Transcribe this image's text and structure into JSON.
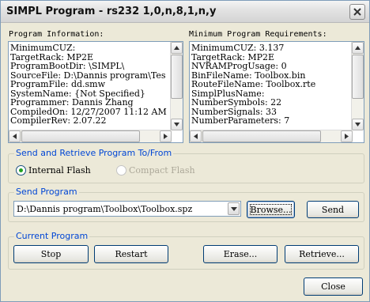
{
  "window": {
    "title": "SIMPL Program - rs232 1,0,n,8,1,n,y"
  },
  "program_info": {
    "label": "Program Information:",
    "lines": [
      "MinimumCUZ:",
      "TargetRack: MP2E",
      "ProgramBootDir: \\SIMPL\\",
      "SourceFile: D:\\Dannis program\\Tes",
      "ProgramFile: dd.smw",
      "SystemName: {Not Specified}",
      "Programmer: Dannis Zhang",
      "CompiledOn: 12/27/2007 11:12 AM",
      "CompilerRev: 2.07.22"
    ]
  },
  "min_requirements": {
    "label": "Minimum Program Requirements:",
    "lines": [
      "MinimumCUZ: 3.137",
      "TargetRack: MP2E",
      "NVRAMProgUsage: 0",
      "BinFileName: Toolbox.bin",
      "RouteFileName: Toolbox.rte",
      "SimplPlusName:",
      "NumberSymbols: 22",
      "NumberSignals: 33",
      "NumberParameters: 7"
    ]
  },
  "send_retrieve": {
    "label": "Send and Retrieve Program To/From",
    "internal_flash": "Internal Flash",
    "compact_flash": "Compact Flash",
    "selected": "Internal Flash"
  },
  "send_program": {
    "label": "Send Program",
    "path": "D:\\Dannis program\\Toolbox\\Toolbox.spz",
    "browse": "Browse...",
    "send": "Send"
  },
  "current_program": {
    "label": "Current Program",
    "stop": "Stop",
    "restart": "Restart",
    "erase": "Erase...",
    "retrieve": "Retrieve..."
  },
  "close_button": "Close"
}
